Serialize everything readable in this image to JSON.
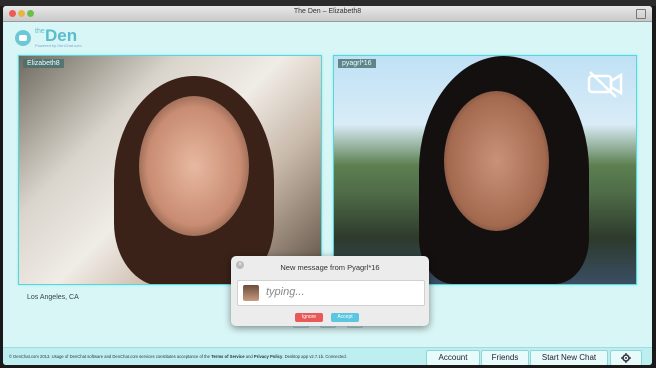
{
  "window": {
    "title": "The Den – Elizabeth8"
  },
  "logo": {
    "the": "the",
    "den": "Den",
    "tagline": "Powered by DenChat.com"
  },
  "video_left": {
    "name": "Elizabeth8",
    "location": "Los Angeles, CA"
  },
  "video_right": {
    "name": "pyagrl*16",
    "camera_icon": "camera-off-icon"
  },
  "dialog": {
    "title": "New message from Pyagrl*16",
    "message": "typing...",
    "ignore_label": "Ignore",
    "accept_label": "Accept"
  },
  "footer": {
    "legal_prefix": "© DenChat.com 2013. Usage of DenChat software and DenChat.com services constitutes acceptance of the",
    "terms": "Terms of Service",
    "and": "and",
    "privacy": "Privacy Policy",
    "version": "Desktop app v2.7.1b.",
    "status": "Connected.",
    "account_label": "Account",
    "friends_label": "Friends",
    "start_label": "Start New Chat",
    "gear_icon": "gear-icon"
  },
  "colors": {
    "accent": "#5dd3d8",
    "ignore": "#e85a5a",
    "accept": "#5bc6e0",
    "background": "#d9f6f6"
  }
}
